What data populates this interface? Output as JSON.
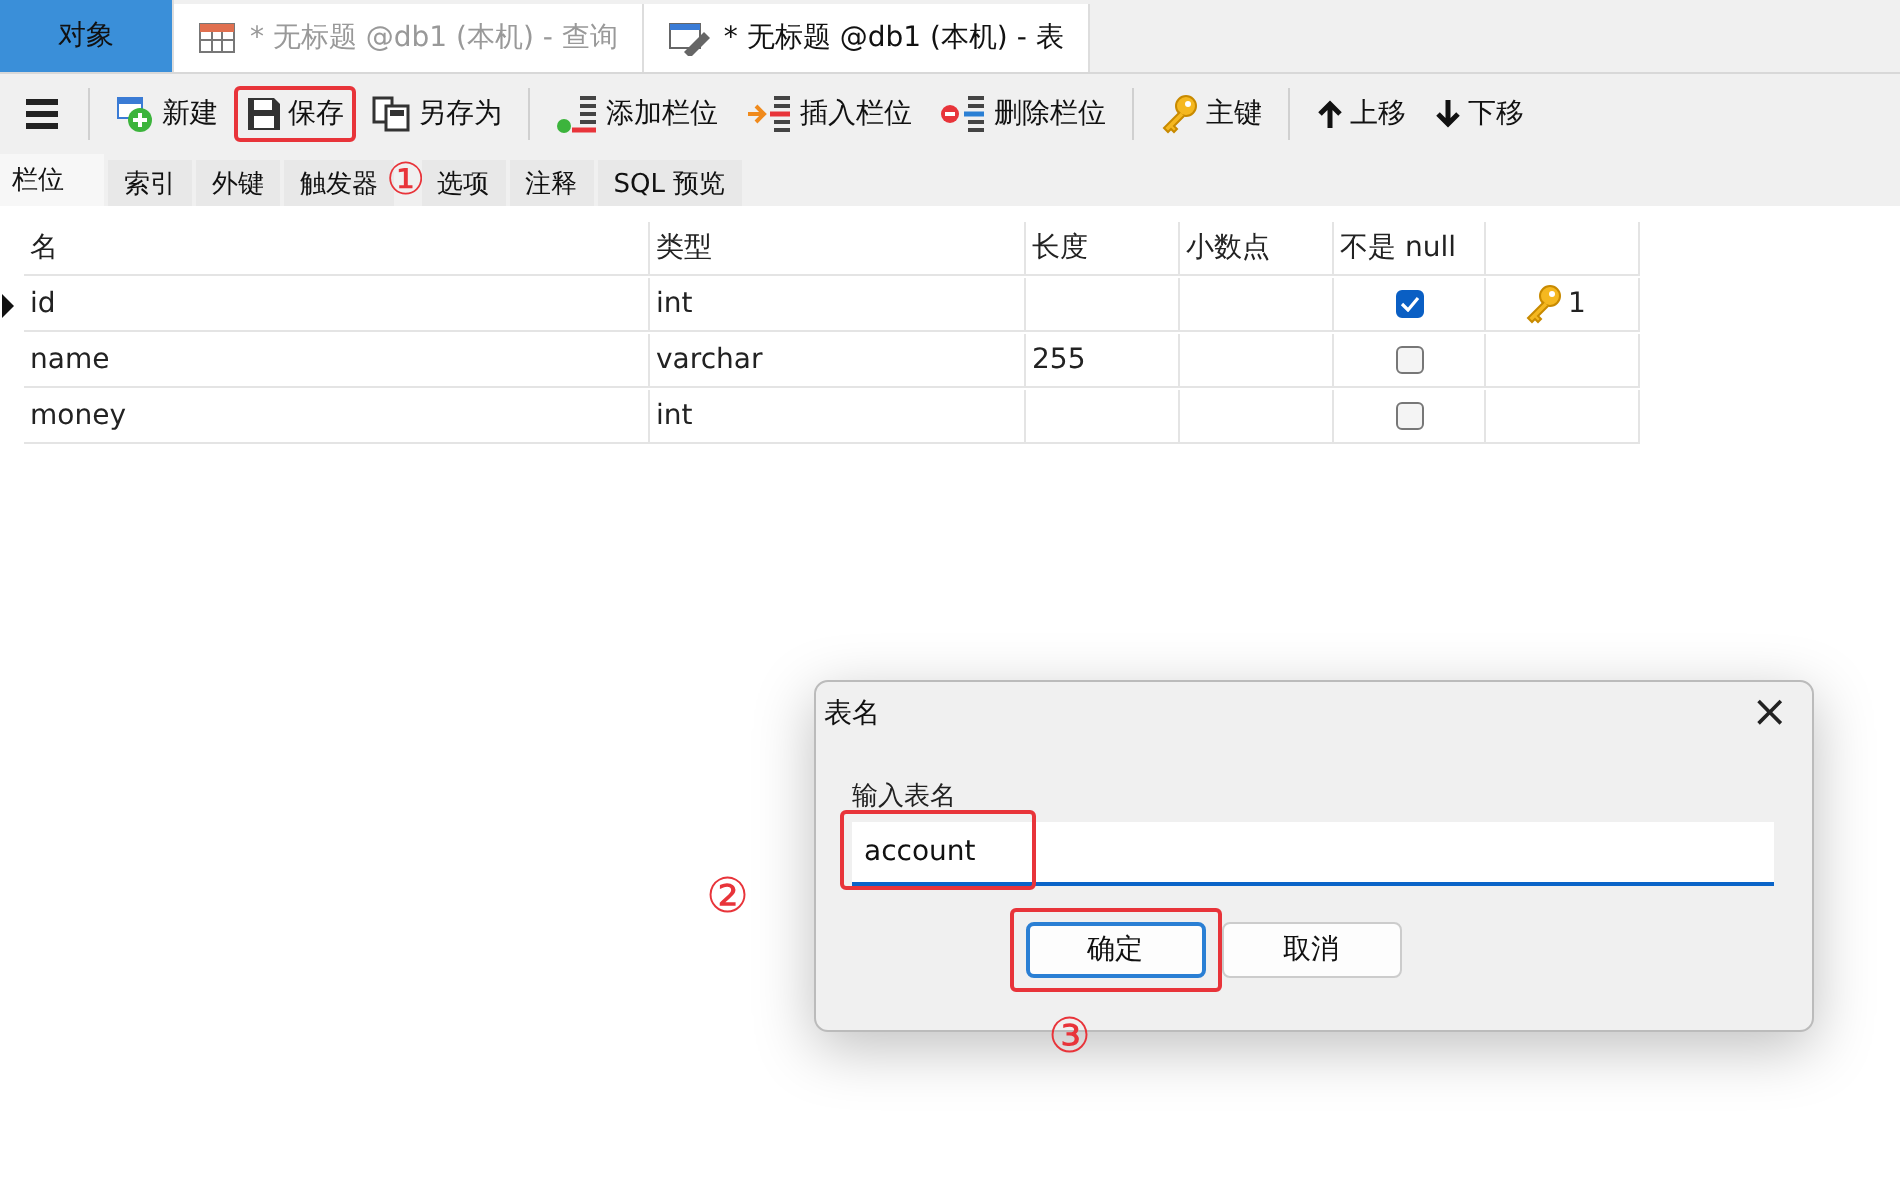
{
  "doc_tabs": [
    {
      "label": "对象",
      "selected": true
    },
    {
      "label": "* 无标题 @db1 (本机) - 查询",
      "selected": false
    },
    {
      "label": "* 无标题 @db1 (本机) - 表",
      "selected": true
    }
  ],
  "toolbar": [
    {
      "kind": "menu"
    },
    {
      "kind": "sep"
    },
    {
      "kind": "new",
      "label": "新建",
      "highlighted": false
    },
    {
      "kind": "save",
      "label": "保存",
      "highlighted": true
    },
    {
      "kind": "saveas",
      "label": "另存为",
      "highlighted": false
    },
    {
      "kind": "sep"
    },
    {
      "kind": "addcol",
      "label": "添加栏位",
      "highlighted": false
    },
    {
      "kind": "inscol",
      "label": "插入栏位",
      "highlighted": false
    },
    {
      "kind": "delcol",
      "label": "删除栏位",
      "highlighted": false
    },
    {
      "kind": "sep"
    },
    {
      "kind": "key",
      "label": "主键",
      "highlighted": false
    },
    {
      "kind": "sep"
    },
    {
      "kind": "up",
      "label": "上移",
      "highlighted": false
    },
    {
      "kind": "down",
      "label": "下移",
      "highlighted": false
    }
  ],
  "sub_tabs": [
    {
      "label": "栏位",
      "selected": true
    },
    {
      "label": "索引",
      "selected": false
    },
    {
      "label": "外键",
      "selected": false
    },
    {
      "label": "触发器",
      "selected": false
    },
    {
      "label": "选项",
      "selected": false
    },
    {
      "label": "注释",
      "selected": false
    },
    {
      "label": "SQL 预览",
      "selected": false
    }
  ],
  "table": {
    "columns": [
      "名",
      "类型",
      "长度",
      "小数点",
      "不是 null"
    ],
    "rows": [
      {
        "current": true,
        "name": "id",
        "type": "int",
        "length": "",
        "decimals": "",
        "not_null": true,
        "key": "1"
      },
      {
        "current": false,
        "name": "name",
        "type": "varchar",
        "length": "255",
        "decimals": "",
        "not_null": false,
        "key": ""
      },
      {
        "current": false,
        "name": "money",
        "type": "int",
        "length": "",
        "decimals": "",
        "not_null": false,
        "key": ""
      }
    ]
  },
  "dialog": {
    "title": "表名",
    "close": "×",
    "label": "输入表名",
    "value": "account",
    "value_highlighted": true,
    "buttons": [
      {
        "label": "确定",
        "default": true,
        "highlighted": true
      },
      {
        "label": "取消",
        "default": false,
        "highlighted": false
      }
    ]
  },
  "annotations": [
    "①",
    "②",
    "③"
  ]
}
